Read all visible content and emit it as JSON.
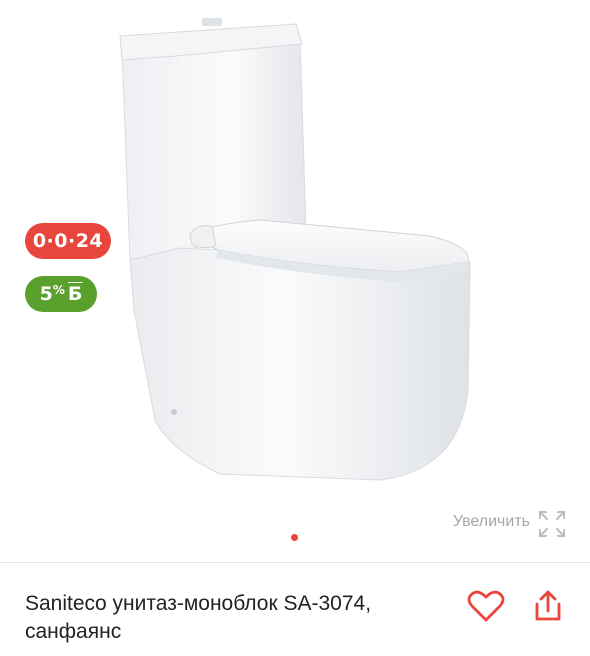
{
  "product": {
    "title": "Saniteco унитаз-моноблок SA-3074, санфаянс",
    "image_icon": "toilet-product-image"
  },
  "badges": {
    "installment": "0·0·24",
    "bonus_value": "5",
    "bonus_percent": "%",
    "bonus_letter": "Б"
  },
  "gallery": {
    "zoom_label": "Увеличить",
    "zoom_icon": "expand-icon",
    "pager_dots": 1
  },
  "actions": {
    "favorite_icon": "heart-icon",
    "share_icon": "share-icon"
  },
  "colors": {
    "accent": "#e8453c",
    "bonus_green": "#5aa02c",
    "muted_text": "#a6a6a6"
  }
}
